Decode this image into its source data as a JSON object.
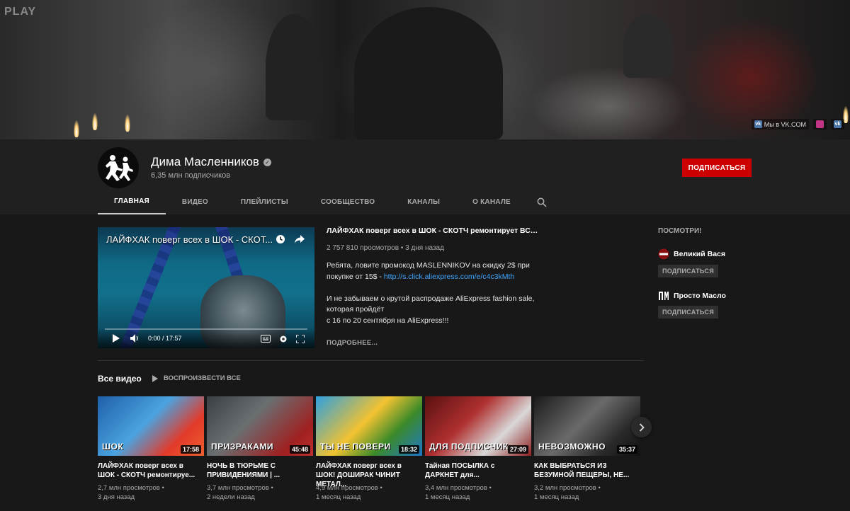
{
  "banner": {
    "logo": "PLAY",
    "links": [
      "Мы в VK.COM",
      "",
      ""
    ]
  },
  "channel": {
    "name": "Дима Масленников",
    "subscribers": "6,35 млн подписчиков",
    "subscribe_label": "ПОДПИСАТЬСЯ"
  },
  "tabs": [
    "ГЛАВНАЯ",
    "ВИДЕО",
    "ПЛЕЙЛИСТЫ",
    "СООБЩЕСТВО",
    "КАНАЛЫ",
    "О КАНАЛЕ"
  ],
  "featured": {
    "player_title": "ЛАЙФХАК поверг всех в ШОК - СКОТ...",
    "time": "0:00 / 17:57",
    "progress": 0,
    "title": "ЛАЙФХАК поверг всех в ШОК - СКОТЧ ремонтирует ВСЁ + ...",
    "meta": "2 757 810 просмотров • 3 дня назад",
    "desc_line1": "Ребята, ловите промокод MASLENNIKOV на скидку 2$ при покупке от 15$ - ",
    "desc_link": "http://s.click.aliexpress.com/e/c4c3kMth",
    "desc_line2": "И не забываем о крутой распродаже AliExpress fashion sale, которая пройдёт",
    "desc_line3": "с 16 по 20 сентября на AliExpress!!!",
    "more": "ПОДРОБНЕЕ..."
  },
  "sidebar": {
    "title": "ПОСМОТРИ!",
    "channels": [
      {
        "name": "Великий Вася",
        "button": "ПОДПИСАТЬСЯ"
      },
      {
        "name": "Просто Масло",
        "button": "ПОДПИСАТЬСЯ"
      }
    ]
  },
  "all_videos": {
    "title": "Все видео",
    "play_all": "ВОСПРОИЗВЕСТИ ВСЕ",
    "videos": [
      {
        "caption": "ШОК",
        "duration": "17:58",
        "title": "ЛАЙФХАК поверг всех в ШОК - СКОТЧ ремонтируе...",
        "views": "2,7 млн просмотров •",
        "age": "3 дня назад"
      },
      {
        "caption": "ПРИЗРАКАМИ",
        "duration": "45:48",
        "title": "НОЧЬ В ТЮРЬМЕ С ПРИВИДЕНИЯМИ | ...",
        "views": "3,7 млн просмотров •",
        "age": "2 недели назад"
      },
      {
        "caption": "ТЫ НЕ ПОВЕРИ",
        "duration": "18:32",
        "title": "ЛАЙФХАК поверг всех в ШОК! ДОШИРАК ЧИНИТ МЕТАЛ...",
        "views": "4,9 млн просмотров •",
        "age": "1 месяц назад"
      },
      {
        "caption": "ДЛЯ ПОДПИСЧИК",
        "duration": "27:09",
        "title": "Тайная ПОСЫЛКА с ДАРКНЕТ для...",
        "views": "3,4 млн просмотров •",
        "age": "1 месяц назад"
      },
      {
        "caption": "НЕВОЗМОЖНО",
        "duration": "35:37",
        "title": "КАК ВЫБРАТЬСЯ ИЗ БЕЗУМНОЙ ПЕЩЕРЫ, НЕ...",
        "views": "3,2 млн просмотров •",
        "age": "1 месяц назад"
      }
    ]
  },
  "colors": {
    "subscribe": "#cc0000",
    "link": "#3ea6ff",
    "bg": "#181818",
    "header": "#202020"
  }
}
